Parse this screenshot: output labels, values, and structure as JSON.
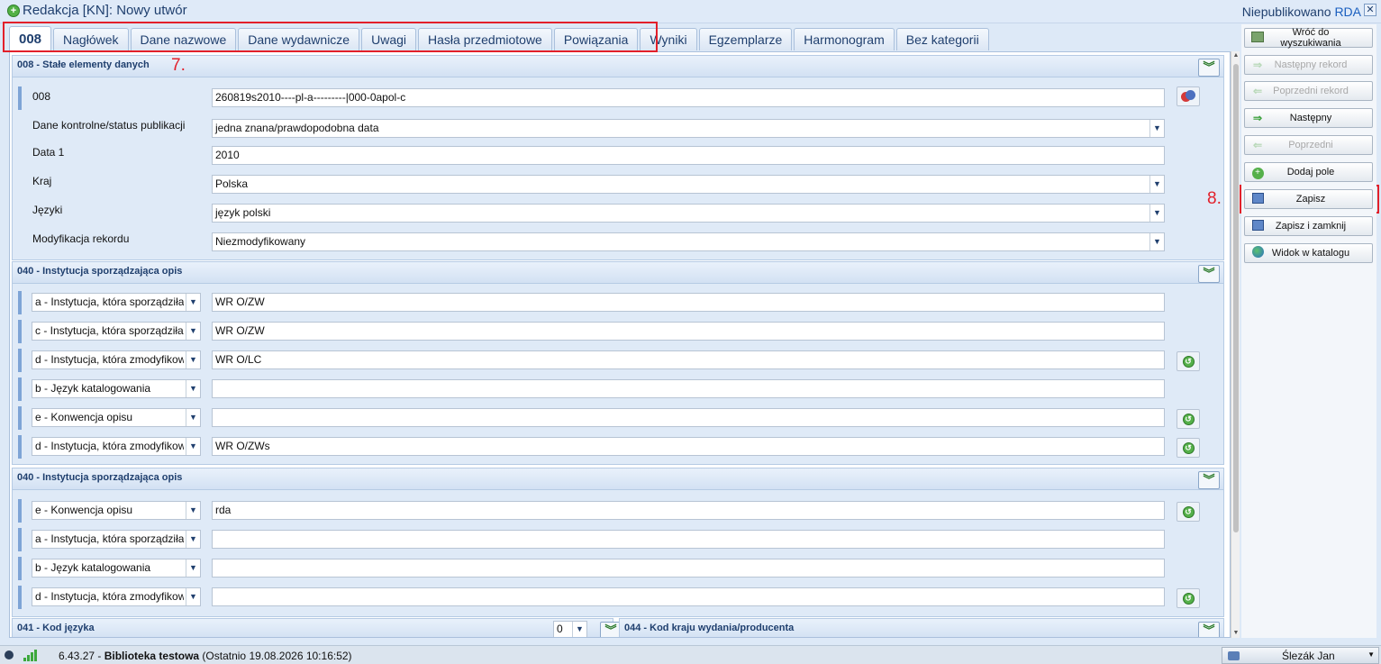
{
  "window": {
    "title": "Redakcja [KN]: Nowy utwór",
    "status": "Niepublikowano",
    "status_tag": "RDA"
  },
  "tabs": [
    "008",
    "Nagłówek",
    "Dane nazwowe",
    "Dane wydawnicze",
    "Uwagi",
    "Hasła przedmiotowe",
    "Powiązania",
    "Wyniki",
    "Egzemplarze",
    "Harmonogram",
    "Bez kategorii"
  ],
  "annotations": {
    "tabs_mark": "7.",
    "save_mark": "8."
  },
  "sec008": {
    "title": "008 - Stałe elementy danych",
    "fields": [
      {
        "label": "008",
        "value": "260819s2010----pl-a---------|000-0apol-c"
      },
      {
        "label": "Dane kontrolne/status publikacji",
        "value": "jedna znana/prawdopodobna data"
      },
      {
        "label": "Data 1",
        "value": "2010"
      },
      {
        "label": "Kraj",
        "value": "Polska"
      },
      {
        "label": "Języki",
        "value": "język polski"
      },
      {
        "label": "Modyfikacja rekordu",
        "value": "Niezmodyfikowany"
      }
    ]
  },
  "sec040a": {
    "title": "040 - Instytucja sporządzająca opis",
    "rows": [
      {
        "sub": "a - Instytucja, która sporządziła",
        "value": "WR O/ZW"
      },
      {
        "sub": "c - Instytucja, która sporządziła",
        "value": "WR O/ZW"
      },
      {
        "sub": "d - Instytucja, która zmodyfikowała",
        "value": "WR O/LC"
      },
      {
        "sub": "b - Język katalogowania",
        "value": ""
      },
      {
        "sub": "e - Konwencja opisu",
        "value": ""
      },
      {
        "sub": "d - Instytucja, która zmodyfikowała",
        "value": "WR O/ZWs"
      }
    ]
  },
  "sec040b": {
    "title": "040 - Instytucja sporządzająca opis",
    "rows": [
      {
        "sub": "e - Konwencja opisu",
        "value": "rda"
      },
      {
        "sub": "a - Instytucja, która sporządziła",
        "value": ""
      },
      {
        "sub": "b - Język katalogowania",
        "value": ""
      },
      {
        "sub": "d - Instytucja, która zmodyfikowała",
        "value": ""
      }
    ]
  },
  "sec041": {
    "title": "041 - Kod języka",
    "count": "0"
  },
  "sec044": {
    "title": "044 - Kod kraju wydania/producenta"
  },
  "panel": {
    "back": "Wróć do wyszukiwania",
    "next_record": "Następny rekord",
    "prev_record": "Poprzedni rekord",
    "next": "Następny",
    "prev": "Poprzedni",
    "add_field": "Dodaj pole",
    "save": "Zapisz",
    "save_close": "Zapisz i zamknij",
    "catalog_view": "Widok w katalogu"
  },
  "statusbar": {
    "version": "6.43.27",
    "library": "Biblioteka testowa",
    "last": "(Ostatnio 19.08.2026 10:16:52)",
    "user": "Ślezák Jan"
  },
  "colors": {
    "accent": "#1f3f6e",
    "highlight": "#e2202a",
    "marker": "#7ea4d6"
  }
}
